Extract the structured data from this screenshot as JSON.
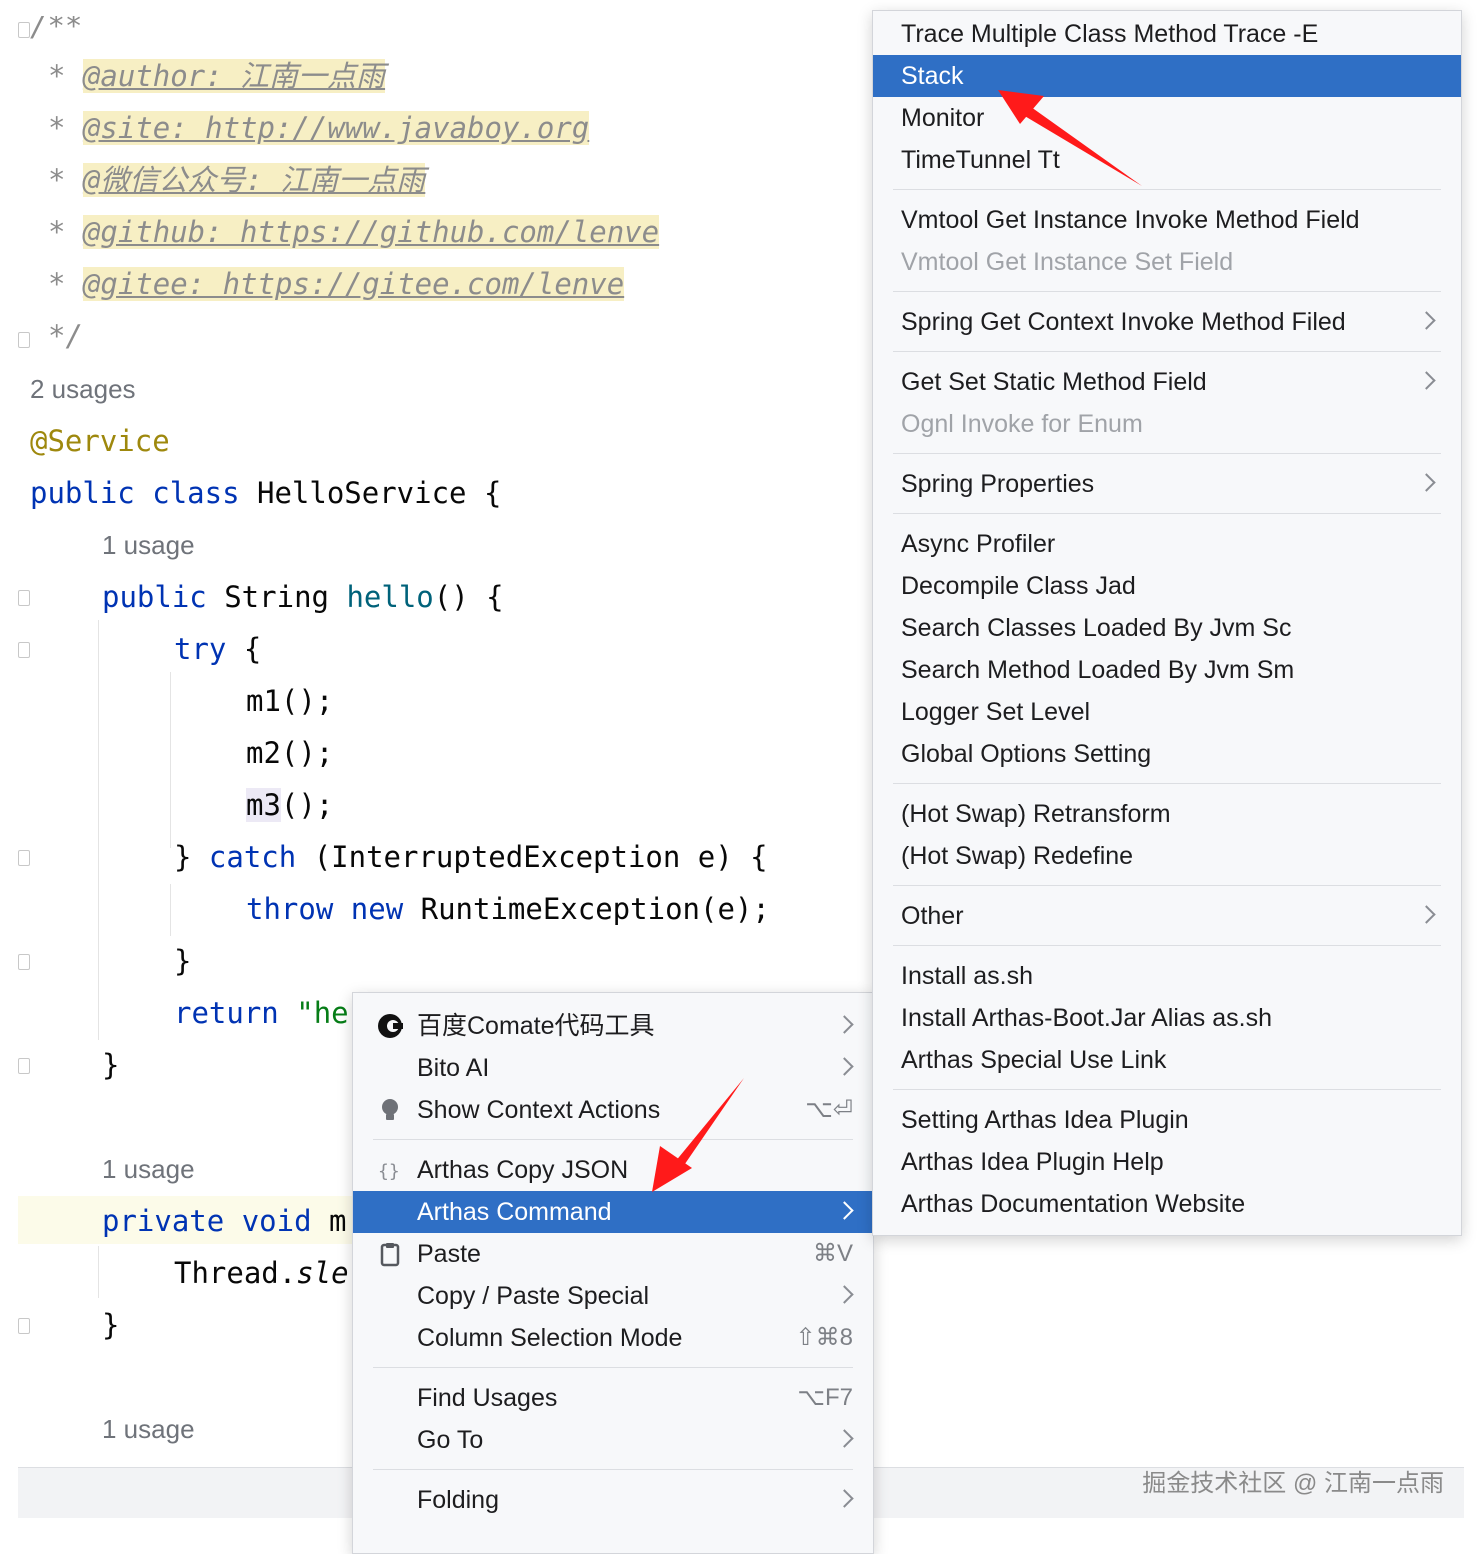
{
  "editor": {
    "javadoc_open": "/**",
    "doc_lines": [
      {
        "star": "* ",
        "tag": "@author: 江南一点雨"
      },
      {
        "star": "* ",
        "tag": "@site: http://www.javaboy.org"
      },
      {
        "star": "* ",
        "tag": "@微信公众号: 江南一点雨"
      },
      {
        "star": "* ",
        "tag": "@github: https://github.com/lenve"
      },
      {
        "star": "* ",
        "tag": "@gitee: https://gitee.com/lenve"
      }
    ],
    "javadoc_close": "*/",
    "usages_class": "2 usages",
    "annotation": "@Service",
    "kw_public": "public",
    "kw_class": "class",
    "class_decl_rest": " HelloService {",
    "usage_hello": "1 usage",
    "kw_string": " String ",
    "method_hello": "hello",
    "hello_rest": "() {",
    "kw_try": "try",
    "try_rest": " {",
    "call_m1": "m1();",
    "call_m2": "m2();",
    "call_m3_name": "m3",
    "call_m3_rest": "();",
    "catch_open": "} ",
    "kw_catch": "catch",
    "catch_rest": " (InterruptedException e) {",
    "kw_throw": "throw",
    "kw_new": "new",
    "throw_rest": " RuntimeException(e);",
    "close_brace": "}",
    "kw_return": "return",
    "return_str": "\"he",
    "usage_m1": "1 usage",
    "kw_private": "private",
    "kw_void": "void",
    "private_rest": "m",
    "thread_call": "Thread.",
    "thread_sleep": "sle",
    "usage_bottom": "1 usage"
  },
  "context_menu": {
    "items": [
      {
        "label": "百度Comate代码工具",
        "icon": "comate-icon",
        "submenu": true
      },
      {
        "label": "Bito AI",
        "submenu": true
      },
      {
        "label": "Show Context Actions",
        "icon": "lightbulb-icon",
        "shortcut": "⌥⏎"
      },
      {
        "label": "Arthas Copy JSON",
        "icon": "braces-icon"
      },
      {
        "label": "Arthas Command",
        "submenu": true,
        "selected": true
      },
      {
        "label": "Paste",
        "icon": "clipboard-icon",
        "shortcut": "⌘V"
      },
      {
        "label": "Copy / Paste Special",
        "submenu": true
      },
      {
        "label": "Column Selection Mode",
        "shortcut": "⇧⌘8"
      },
      {
        "label": "Find Usages",
        "shortcut": "⌥F7"
      },
      {
        "label": "Go To",
        "submenu": true
      },
      {
        "label": "Folding",
        "submenu": true
      }
    ]
  },
  "submenu": {
    "items": [
      {
        "label": "Trace Multiple Class Method Trace -E"
      },
      {
        "label": "Stack",
        "selected": true
      },
      {
        "label": "Monitor"
      },
      {
        "label": "TimeTunnel Tt"
      },
      {
        "label": "Vmtool Get Instance Invoke Method Field"
      },
      {
        "label": "Vmtool Get Instance Set Field",
        "disabled": true
      },
      {
        "label": "Spring Get Context Invoke Method Filed",
        "submenu": true
      },
      {
        "label": "Get Set Static Method Field",
        "submenu": true
      },
      {
        "label": "Ognl Invoke for Enum",
        "disabled": true
      },
      {
        "label": "Spring Properties",
        "submenu": true
      },
      {
        "label": "Async Profiler"
      },
      {
        "label": "Decompile Class Jad"
      },
      {
        "label": "Search Classes Loaded By Jvm Sc"
      },
      {
        "label": "Search Method Loaded By Jvm Sm"
      },
      {
        "label": "Logger Set Level"
      },
      {
        "label": "Global Options Setting"
      },
      {
        "label": "(Hot Swap) Retransform"
      },
      {
        "label": "(Hot Swap) Redefine"
      },
      {
        "label": "Other",
        "submenu": true
      },
      {
        "label": "Install as.sh"
      },
      {
        "label": "Install Arthas-Boot.Jar Alias as.sh"
      },
      {
        "label": "Arthas Special Use Link"
      },
      {
        "label": "Setting Arthas Idea Plugin"
      },
      {
        "label": "Arthas Idea Plugin Help"
      },
      {
        "label": "Arthas Documentation Website"
      }
    ]
  },
  "watermark": "掘金技术社区 @ 江南一点雨",
  "colors": {
    "selection": "#2f6fc5",
    "arrow": "#ff1a1a",
    "keyword": "#0033b3",
    "doc_highlight": "#f7efc4"
  }
}
